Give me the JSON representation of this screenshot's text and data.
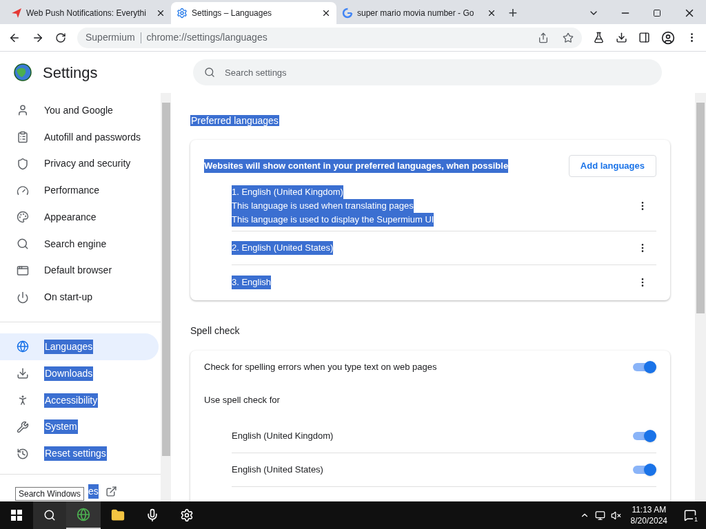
{
  "tabs": [
    {
      "title": "Web Push Notifications: Everythi",
      "kind": "push",
      "selected": false
    },
    {
      "title": "Settings – Languages",
      "kind": "gear",
      "selected": true
    },
    {
      "title": "super mario movia number - Go",
      "kind": "google",
      "selected": false
    }
  ],
  "new_tab": "+",
  "omnibox": {
    "site": "Supermium",
    "url": "chrome://settings/languages"
  },
  "header": {
    "title": "Settings",
    "search_placeholder": "Search settings"
  },
  "sidebar": {
    "items": [
      {
        "label": "You and Google",
        "kind": "person",
        "selected": false,
        "highlighted": false
      },
      {
        "label": "Autofill and passwords",
        "kind": "clipboard",
        "selected": false,
        "highlighted": false
      },
      {
        "label": "Privacy and security",
        "kind": "shield",
        "selected": false,
        "highlighted": false
      },
      {
        "label": "Performance",
        "kind": "gauge",
        "selected": false,
        "highlighted": false
      },
      {
        "label": "Appearance",
        "kind": "palette",
        "selected": false,
        "highlighted": false
      },
      {
        "label": "Search engine",
        "kind": "search",
        "selected": false,
        "highlighted": false
      },
      {
        "label": "Default browser",
        "kind": "browser",
        "selected": false,
        "highlighted": false
      },
      {
        "label": "On start-up",
        "kind": "power",
        "selected": false,
        "highlighted": false
      },
      {
        "label": "Languages",
        "kind": "globe",
        "selected": true,
        "highlighted": true
      },
      {
        "label": "Downloads",
        "kind": "download",
        "selected": false,
        "highlighted": true
      },
      {
        "label": "Accessibility",
        "kind": "accessibility",
        "selected": false,
        "highlighted": true
      },
      {
        "label": "System",
        "kind": "wrench",
        "selected": false,
        "highlighted": true
      },
      {
        "label": "Reset settings",
        "kind": "history",
        "selected": false,
        "highlighted": true
      }
    ],
    "footer_item": {
      "label": "es",
      "highlighted": true
    }
  },
  "tooltip": "Search Windows",
  "preferred": {
    "heading": "Preferred languages",
    "heading_highlighted": true,
    "description": "Websites will show content in your preferred languages, when possible",
    "description_highlighted": true,
    "add_button": "Add languages",
    "languages": [
      {
        "lines": [
          "1. English (United Kingdom)",
          "This language is used when translating pages",
          "This language is used to display the Supermium UI"
        ],
        "highlighted": true
      },
      {
        "lines": [
          "2. English (United States)"
        ],
        "highlighted": true
      },
      {
        "lines": [
          "3. English"
        ],
        "highlighted": true
      }
    ]
  },
  "spell_check": {
    "heading": "Spell check",
    "main": {
      "label": "Check for spelling errors when you type text on web pages",
      "on": true
    },
    "use_for": "Use spell check for",
    "languages": [
      {
        "label": "English (United Kingdom)",
        "on": true
      },
      {
        "label": "English (United States)",
        "on": true
      }
    ]
  },
  "taskbar": {
    "time": "11:13 AM",
    "date": "8/20/2024",
    "notifications": "1"
  }
}
